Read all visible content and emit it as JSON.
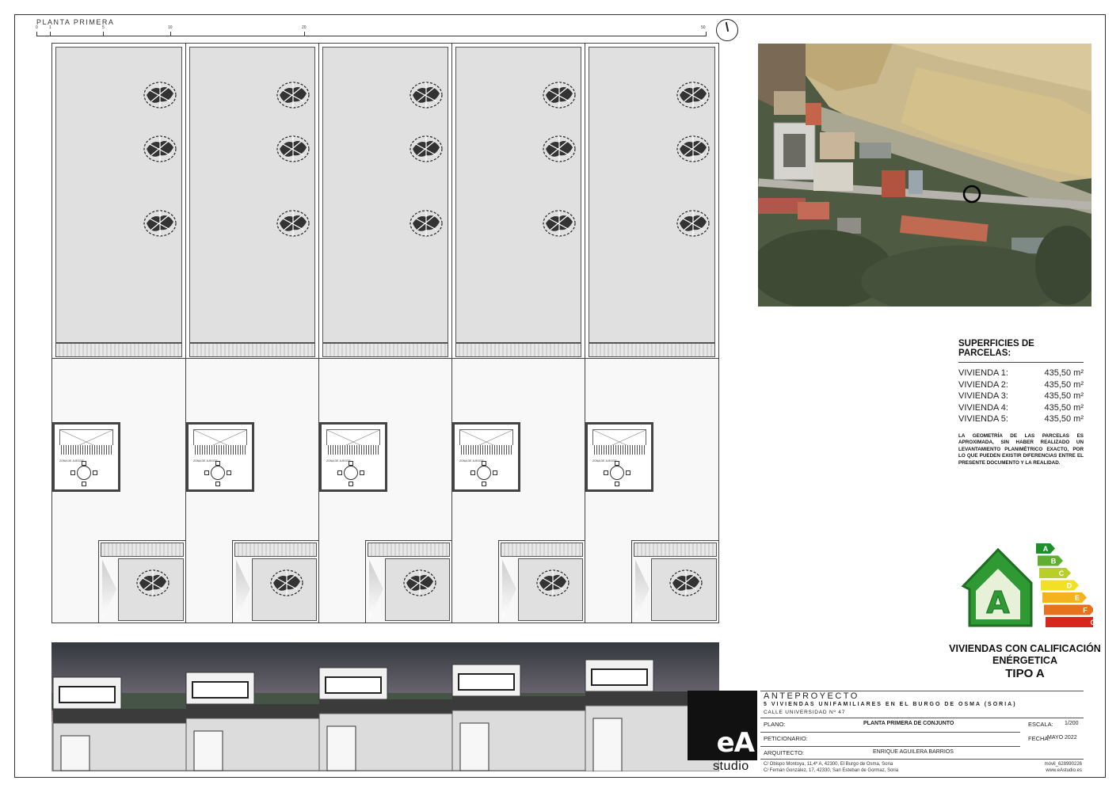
{
  "plan": {
    "title": "PLANTA PRIMERA",
    "scale_labels": [
      "0",
      "1",
      "5",
      "10",
      "20",
      "50"
    ],
    "court_label": "ZONA DE JUEGOS",
    "parcel_count": 5
  },
  "surfaces": {
    "heading": "SUPERFICIES DE PARCELAS:",
    "rows": [
      {
        "label": "VIVIENDA 1:",
        "value": "435,50 m²"
      },
      {
        "label": "VIVIENDA 2:",
        "value": "435,50 m²"
      },
      {
        "label": "VIVIENDA 3:",
        "value": "435,50 m²"
      },
      {
        "label": "VIVIENDA 4:",
        "value": "435,50 m²"
      },
      {
        "label": "VIVIENDA 5:",
        "value": "435,50 m²"
      }
    ],
    "note": "LA GEOMETRÍA DE LAS PARCELAS ES APROXIMADA, SIN HABER REALIZADO UN LEVANTAMIENTO PLANIMÉTRICO EXACTO, POR LO QUE PUEDEN EXISTIR DIFERENCIAS ENTRE EL PRESENTE DOCUMENTO Y LA REALIDAD."
  },
  "energy": {
    "badge_letter": "A",
    "scale": [
      "A",
      "B",
      "C",
      "D",
      "E",
      "F",
      "G"
    ],
    "line1": "VIVIENDAS CON CALIFICACIÓN",
    "line2": "ENÉRGETICA",
    "line3": "TIPO A",
    "colors": [
      "#1f8f2e",
      "#5fae2f",
      "#b8cf2a",
      "#f2e026",
      "#f4b21f",
      "#e8711c",
      "#d9261c"
    ]
  },
  "title_block": {
    "project": "ANTEPROYECTO",
    "subtitle": "5 VIVIENDAS UNIFAMILIARES EN EL BURGO DE OSMA (SORIA)",
    "address": "CALLE UNIVERSIDAD Nº 47",
    "plano_label": "PLANO:",
    "plano_value": "PLANTA PRIMERA DE CONJUNTO",
    "peticionario_label": "PETICIONARIO:",
    "arquitecto_label": "ARQUITECTO:",
    "arquitecto_value": "ENRIQUE AGUILERA BARRIOS",
    "escala_label": "ESCALA:",
    "escala_value": "1/200",
    "fecha_label": "FECHA:",
    "fecha_value": "MAYO 2022",
    "contact1": "C/ Obispo Montoya, 11,4º A, 42300, El Burgo de Osma, Soria",
    "contact2": "C/ Fernán González, 17, 42330, San Esteban de Gormaz, Soria",
    "phone": "móvil_628990226",
    "web": "www.eAstudio.es",
    "logo": "eA",
    "logo_sub": "studio"
  }
}
